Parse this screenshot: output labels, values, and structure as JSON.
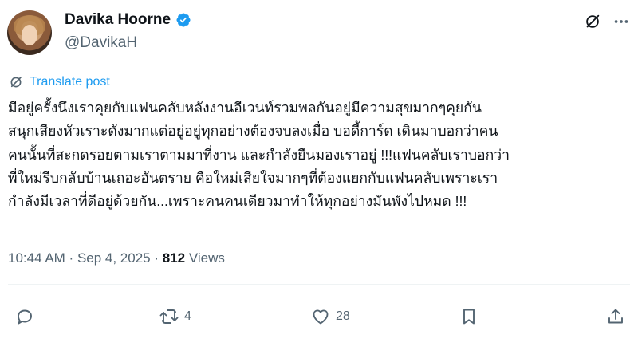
{
  "author": {
    "display_name": "Davika Hoorne",
    "handle": "@DavikaH",
    "verified": true
  },
  "translate_label": "Translate post",
  "post_lines": [
    "มีอยู่ครั้งนึงเราคุยกับแฟนคลับหลังงานอีเวนท์รวมพลกันอยู่มีความสุขมากๆคุยกัน",
    "สนุกเสียงหัวเราะดังมากแต่อยู่อยู่ทุกอย่างต้องจบลงเมื่อ บอดี้การ์ด เดินมาบอกว่าคน",
    "คนนั้นที่สะกดรอยตามเราตามมาที่งาน และกำลังยืนมองเราอยู่ !!!แฟนคลับเราบอกว่า",
    "พี่ใหม่รีบกลับบ้านเถอะอันตราย คือใหม่เสียใจมากๆที่ต้องแยกกับแฟนคลับเพราะเรา",
    "กำลังมีเวลาที่ดีอยู่ด้วยกัน...เพราะคนคนเดียวมาทำให้ทุกอย่างมันพังไปหมด !!!"
  ],
  "meta": {
    "time": "10:44 AM",
    "sep1": " · ",
    "date": "Sep 4, 2025",
    "sep2": " · ",
    "views_count": "812",
    "views_label": " Views"
  },
  "actions": {
    "reply_count": "",
    "repost_count": "4",
    "like_count": "28"
  },
  "icons": {
    "verified": "verified-badge-icon",
    "grok": "grok-icon",
    "more": "more-icon",
    "translate": "translate-icon",
    "reply": "reply-icon",
    "repost": "repost-icon",
    "like": "heart-icon",
    "bookmark": "bookmark-icon",
    "share": "share-icon"
  },
  "colors": {
    "accent": "#1d9bf0",
    "secondary_text": "#536471",
    "primary_text": "#0f1419"
  }
}
